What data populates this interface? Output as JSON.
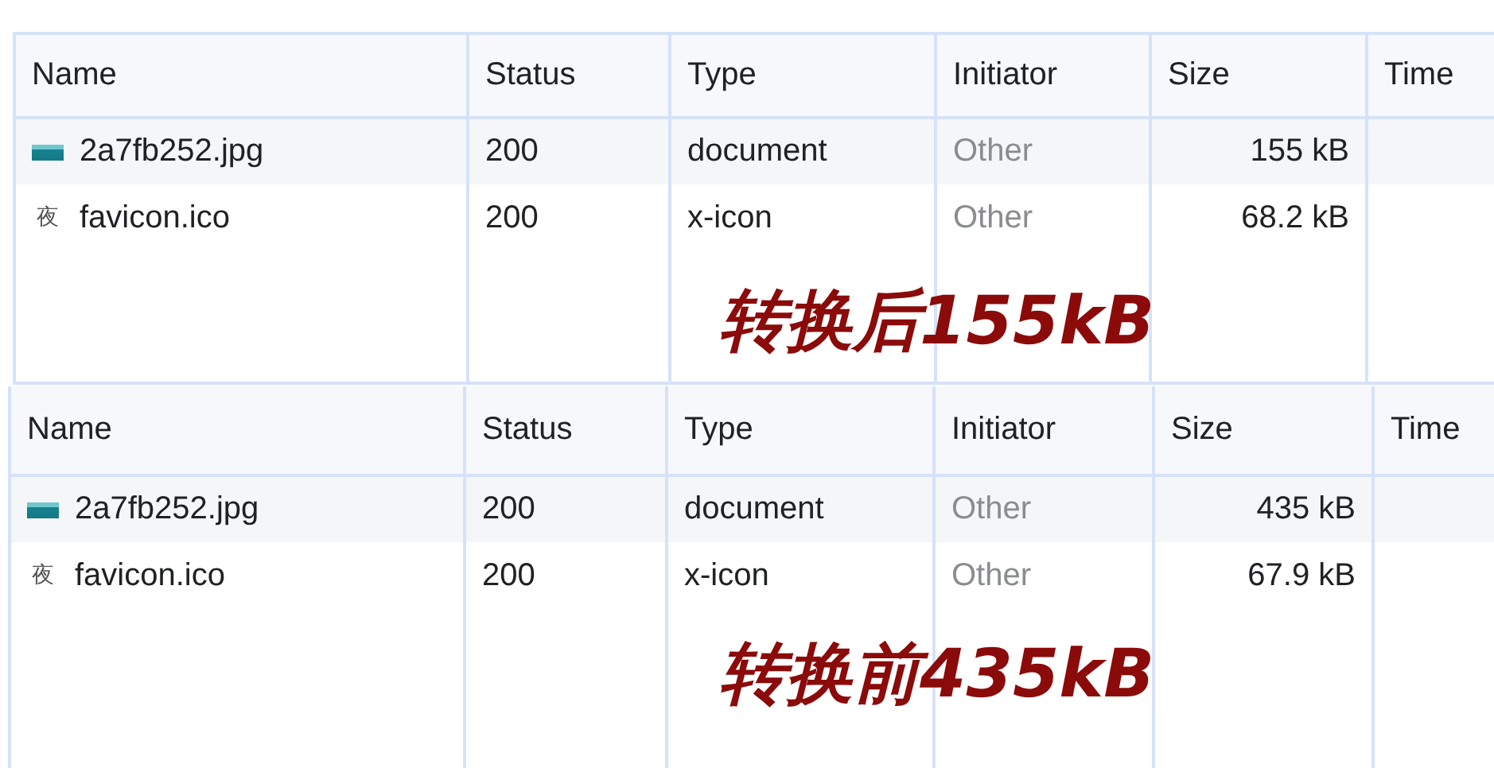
{
  "tables": [
    {
      "columns": [
        "Name",
        "Status",
        "Type",
        "Initiator",
        "Size",
        "Time"
      ],
      "rows": [
        {
          "icon": {
            "kind": "image"
          },
          "name": "2a7fb252.jpg",
          "status": "200",
          "type": "document",
          "initiator": "Other",
          "size": "155 kB"
        },
        {
          "icon": {
            "kind": "glyph",
            "text": "夜"
          },
          "name": "favicon.ico",
          "status": "200",
          "type": "x-icon",
          "initiator": "Other",
          "size": "68.2 kB"
        }
      ],
      "annotation": "转换后155kB"
    },
    {
      "columns": [
        "Name",
        "Status",
        "Type",
        "Initiator",
        "Size",
        "Time"
      ],
      "rows": [
        {
          "icon": {
            "kind": "image"
          },
          "name": "2a7fb252.jpg",
          "status": "200",
          "type": "document",
          "initiator": "Other",
          "size": "435 kB"
        },
        {
          "icon": {
            "kind": "glyph",
            "text": "夜"
          },
          "name": "favicon.ico",
          "status": "200",
          "type": "x-icon",
          "initiator": "Other",
          "size": "67.9 kB"
        }
      ],
      "annotation": "转换前435kB"
    }
  ]
}
